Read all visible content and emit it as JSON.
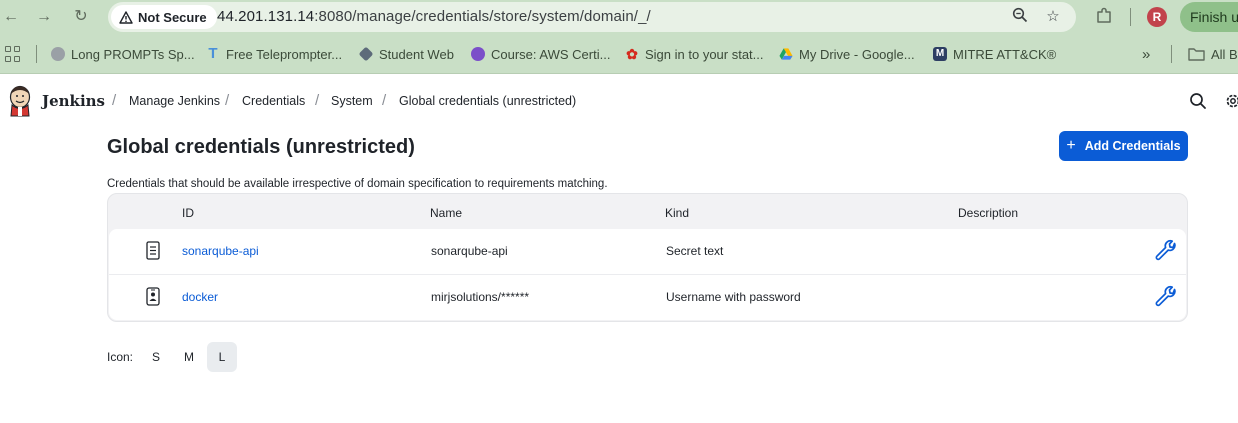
{
  "browser": {
    "security_label": "Not Secure",
    "url_host": "44.201.131.14",
    "url_rest": ":8080/manage/credentials/store/system/domain/_/",
    "profile_initial": "R",
    "finish_label": "Finish u",
    "bookmarks": [
      {
        "label": "Long PROMPTs Sp...",
        "icon": "prompt-favicon",
        "color": "#9aa0a6"
      },
      {
        "label": "Free Teleprompter...",
        "icon": "teleprompter-favicon",
        "color": "#4a90d9"
      },
      {
        "label": "Student Web",
        "icon": "student-web-favicon",
        "color": "#5d6b7a"
      },
      {
        "label": "Course: AWS Certi...",
        "icon": "course-favicon",
        "color": "#7b4fc9"
      },
      {
        "label": "Sign in to your stat...",
        "icon": "maple-leaf-favicon",
        "color": "#d52b1e"
      },
      {
        "label": "My Drive - Google...",
        "icon": "drive-favicon",
        "color": "#1fa463"
      },
      {
        "label": "MITRE ATT&CK®",
        "icon": "mitre-favicon",
        "color": "#2d3e63"
      }
    ],
    "more_bookmarks_icon": "chevron-double-right-icon",
    "all_bookmarks_label": "All B"
  },
  "header": {
    "brand": "Jenkins",
    "breadcrumbs": [
      "Manage Jenkins",
      "Credentials",
      "System",
      "Global credentials (unrestricted)"
    ]
  },
  "page": {
    "title": "Global credentials (unrestricted)",
    "add_button_label": "Add Credentials",
    "description": "Credentials that should be available irrespective of domain specification to requirements matching."
  },
  "table": {
    "columns": [
      "ID",
      "Name",
      "Kind",
      "Description"
    ],
    "rows": [
      {
        "id": "sonarqube-api",
        "name": "sonarqube-api",
        "kind": "Secret text",
        "description": "",
        "icon": "secret-text-icon"
      },
      {
        "id": "docker",
        "name": "mirjsolutions/******",
        "kind": "Username with password",
        "description": "",
        "icon": "username-password-icon"
      }
    ]
  },
  "icon_size": {
    "label": "Icon:",
    "options": [
      "S",
      "M",
      "L"
    ],
    "selected": "L"
  },
  "colors": {
    "accent": "#0b5cd6",
    "browser_chrome": "#c9dfc6"
  }
}
